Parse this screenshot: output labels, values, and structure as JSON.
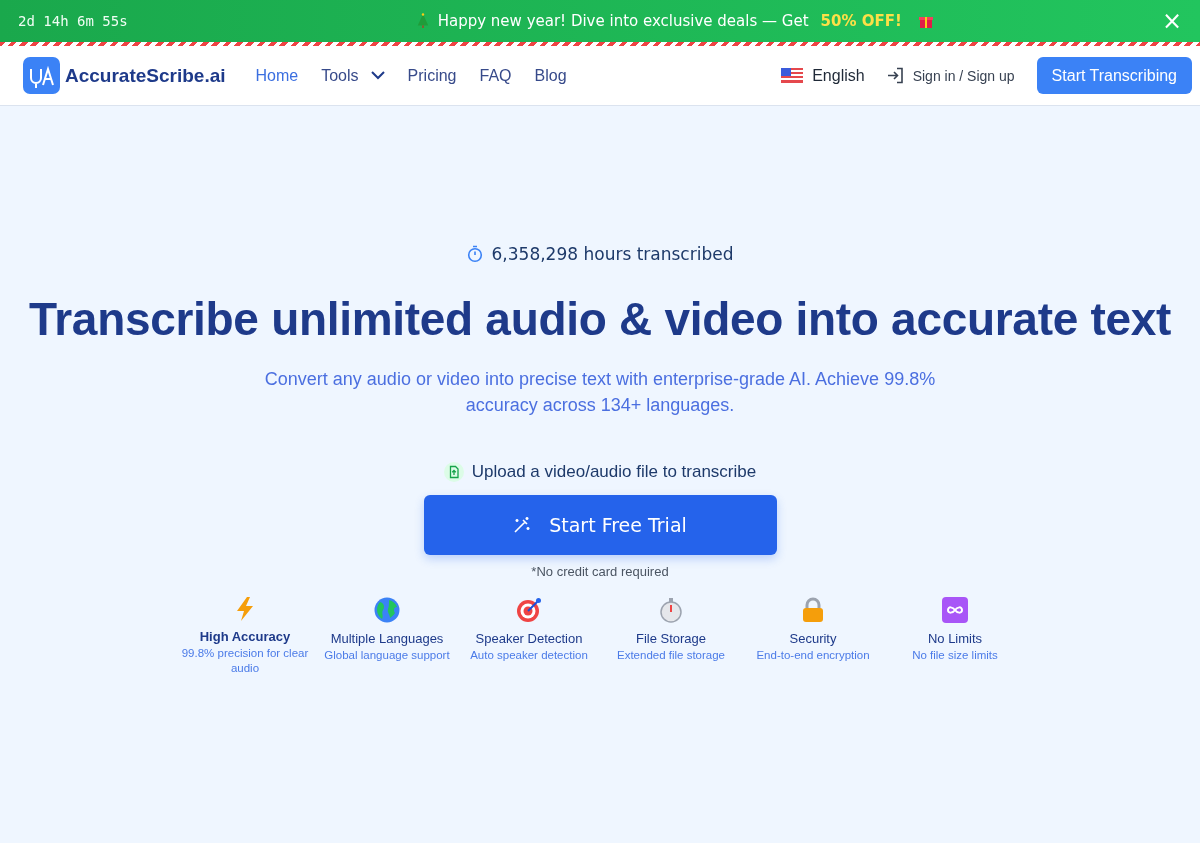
{
  "promo_bar": {
    "countdown": "2d 14h 6m 55s",
    "message": "Happy new year! Dive into exclusive deals — Get",
    "highlight": "50% OFF!",
    "close": "×"
  },
  "nav": {
    "brand": "AccurateScribe.ai",
    "links": [
      {
        "label": "Home",
        "selected": true,
        "dropdown": false
      },
      {
        "label": "Tools",
        "selected": false,
        "dropdown": true
      },
      {
        "label": "Pricing",
        "selected": false,
        "dropdown": false
      },
      {
        "label": "FAQ",
        "selected": false,
        "dropdown": false
      },
      {
        "label": "Blog",
        "selected": false,
        "dropdown": false
      }
    ],
    "language": "English",
    "sign_in": "Sign in / Sign up",
    "cta": "Start Transcribing"
  },
  "hero": {
    "stat": "6,358,298 hours transcribed",
    "title": "Transcribe unlimited audio & video into accurate text",
    "subtitle": "Convert any audio or video into precise text with enterprise-grade AI. Achieve 99.8% accuracy across 134+ languages.",
    "upload_label": "Upload a video/audio file to transcribe",
    "button": "Start Free Trial",
    "note": "*No credit card required"
  },
  "features": [
    {
      "kind": "bolt",
      "title": "High Accuracy",
      "desc": "99.8% precision for clear audio"
    },
    {
      "kind": "globe",
      "title": "Multiple Languages",
      "desc": "Global language support"
    },
    {
      "kind": "target",
      "title": "Speaker Detection",
      "desc": "Auto speaker detection"
    },
    {
      "kind": "stopwatch",
      "title": "File Storage",
      "desc": "Extended file storage"
    },
    {
      "kind": "lock",
      "title": "Security",
      "desc": "End-to-end encryption"
    },
    {
      "kind": "infinity",
      "title": "No Limits",
      "desc": "No file size limits"
    }
  ]
}
